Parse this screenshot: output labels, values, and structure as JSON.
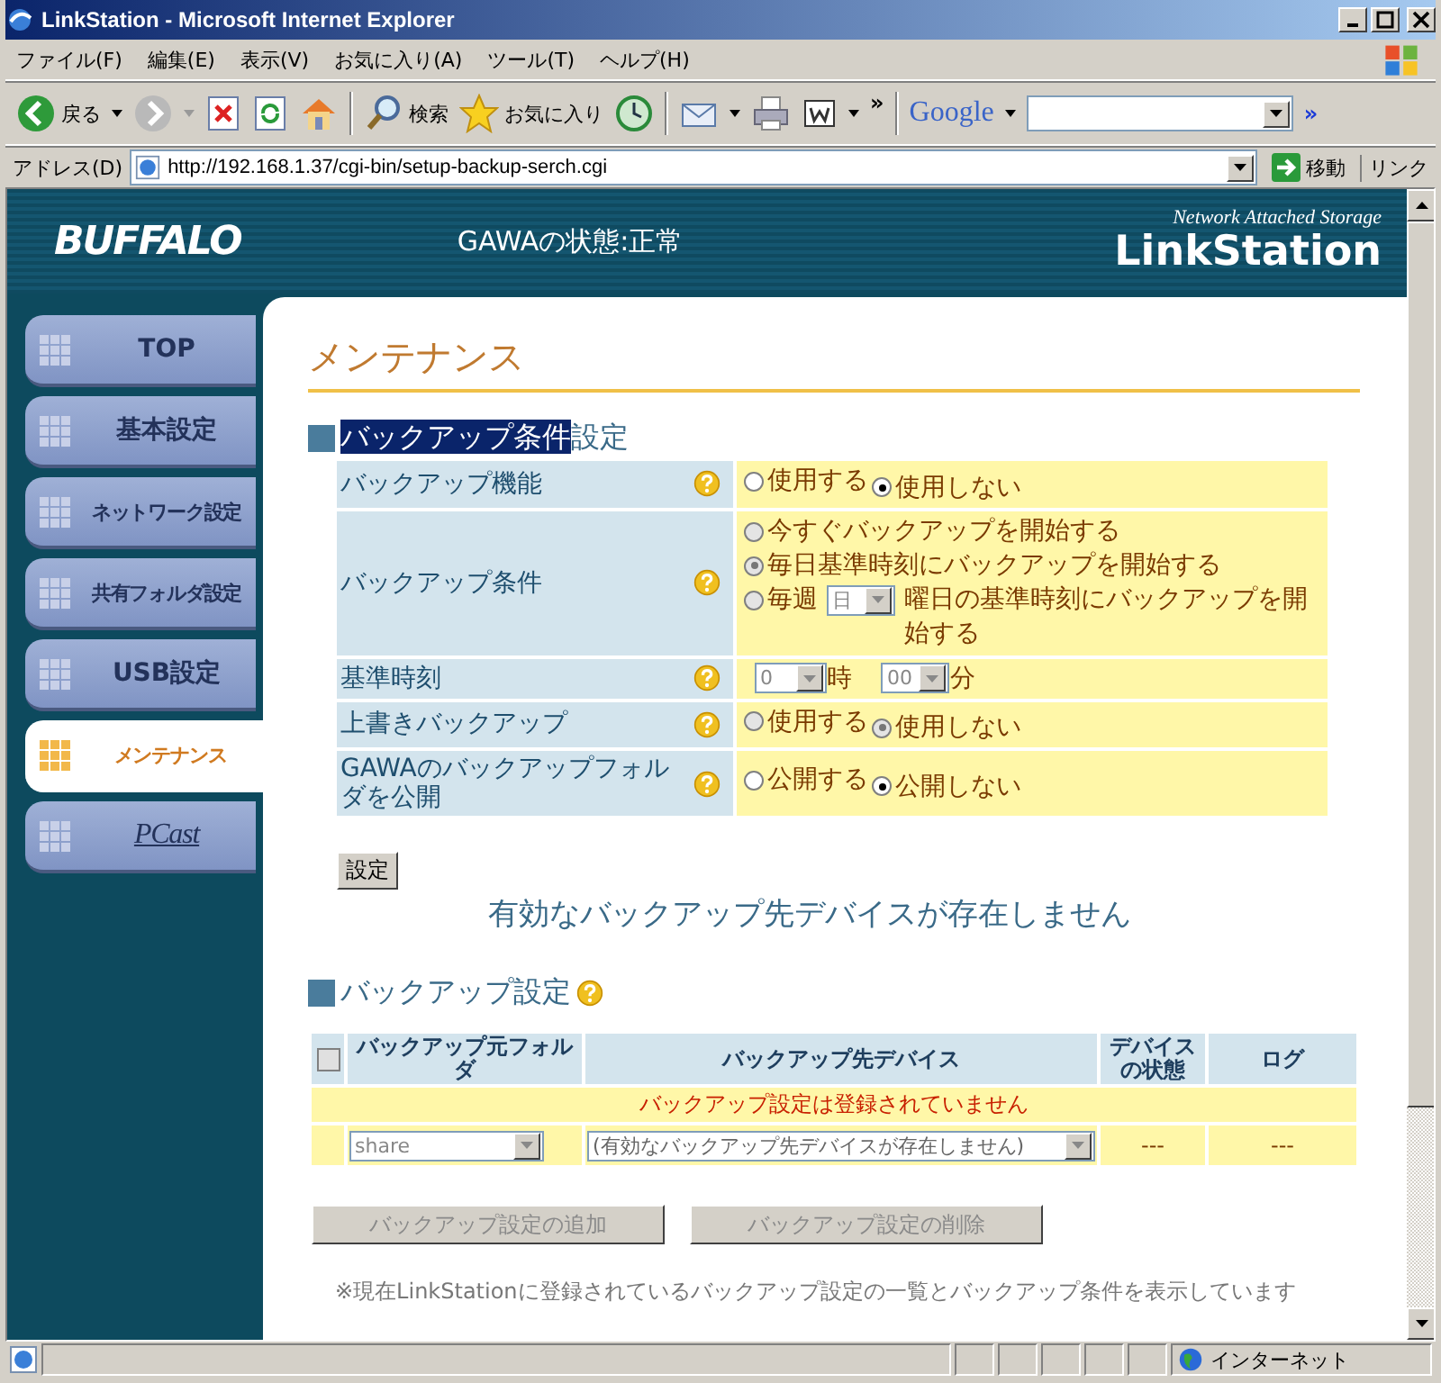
{
  "window": {
    "title": "LinkStation - Microsoft Internet Explorer"
  },
  "menu_bar": [
    "ファイル(F)",
    "編集(E)",
    "表示(V)",
    "お気に入り(A)",
    "ツール(T)",
    "ヘルプ(H)"
  ],
  "toolbar": {
    "back_label": "戻る",
    "search_label": "検索",
    "favorites_label": "お気に入り",
    "more": "»",
    "google_logo": "Google",
    "google_more": "»"
  },
  "address_bar": {
    "label": "アドレス(D)",
    "url": "http://192.168.1.37/cgi-bin/setup-backup-serch.cgi",
    "go": "移動",
    "links": "リンク"
  },
  "header": {
    "logo": "BUFFALO",
    "status": "GAWAの状態:正常",
    "tagline": "Network Attached Storage",
    "product": "LinkStation"
  },
  "nav": [
    {
      "label": "TOP",
      "selected": false,
      "kind": "text"
    },
    {
      "label": "基本設定",
      "selected": false,
      "kind": "text"
    },
    {
      "label": "ネットワーク設定",
      "selected": false,
      "kind": "text"
    },
    {
      "label": "共有フォルダ設定",
      "selected": false,
      "kind": "text"
    },
    {
      "label": "USB設定",
      "selected": false,
      "kind": "text"
    },
    {
      "label": "メンテナンス",
      "selected": true,
      "kind": "text"
    },
    {
      "label": "PCast",
      "selected": false,
      "kind": "logo"
    }
  ],
  "page_title": "メンテナンス",
  "condition_section": {
    "title_highlighted": "バックアップ条件",
    "title_rest": "設定",
    "rows": [
      {
        "kind": "radio",
        "label": "バックアップ機能",
        "options": [
          {
            "label": "使用する",
            "selected": false,
            "disabled": false
          },
          {
            "label": "使用しない",
            "selected": true,
            "disabled": false
          }
        ]
      },
      {
        "kind": "radio-list",
        "label": "バックアップ条件",
        "options": [
          {
            "label": "今すぐバックアップを開始する",
            "selected": false,
            "disabled": true,
            "kind": "plain"
          },
          {
            "label": "毎日基準時刻にバックアップを開始する",
            "selected": true,
            "disabled": true,
            "kind": "plain"
          },
          {
            "label": "毎週",
            "selected": false,
            "disabled": true,
            "kind": "weekly",
            "select": "日",
            "suffix": "曜日の基準時刻にバックアップを開始する"
          }
        ]
      },
      {
        "kind": "time",
        "label": "基準時刻",
        "hour": "0",
        "hour_unit": "時",
        "minute": "00",
        "minute_unit": "分"
      },
      {
        "kind": "radio",
        "label": "上書きバックアップ",
        "options": [
          {
            "label": "使用する",
            "selected": false,
            "disabled": true
          },
          {
            "label": "使用しない",
            "selected": true,
            "disabled": true
          }
        ]
      },
      {
        "kind": "radio",
        "label": "GAWAのバックアップフォルダを公開",
        "options": [
          {
            "label": "公開する",
            "selected": false,
            "disabled": false
          },
          {
            "label": "公開しない",
            "selected": true,
            "disabled": false
          }
        ]
      }
    ],
    "submit": "設定",
    "notice": "有効なバックアップ先デバイスが存在しません"
  },
  "backup_section": {
    "title": "バックアップ設定",
    "table": {
      "select_all": {
        "checked": false
      },
      "columns": [
        "バックアップ元フォルダ",
        "バックアップ先デバイス",
        "デバイスの状態",
        "ログ"
      ],
      "empty_message": "バックアップ設定は登録されていません",
      "new_row": {
        "source": "share",
        "destination": "(有効なバックアップ先デバイスが存在しません)",
        "status": "---",
        "log": "---"
      }
    },
    "buttons": [
      {
        "label": "バックアップ設定の追加",
        "disabled": true
      },
      {
        "label": "バックアップ設定の削除",
        "disabled": true
      }
    ],
    "footnote": "※現在LinkStationに登録されているバックアップ設定の一覧とバックアップ条件を表示しています"
  },
  "status_bar": {
    "zone": "インターネット"
  }
}
